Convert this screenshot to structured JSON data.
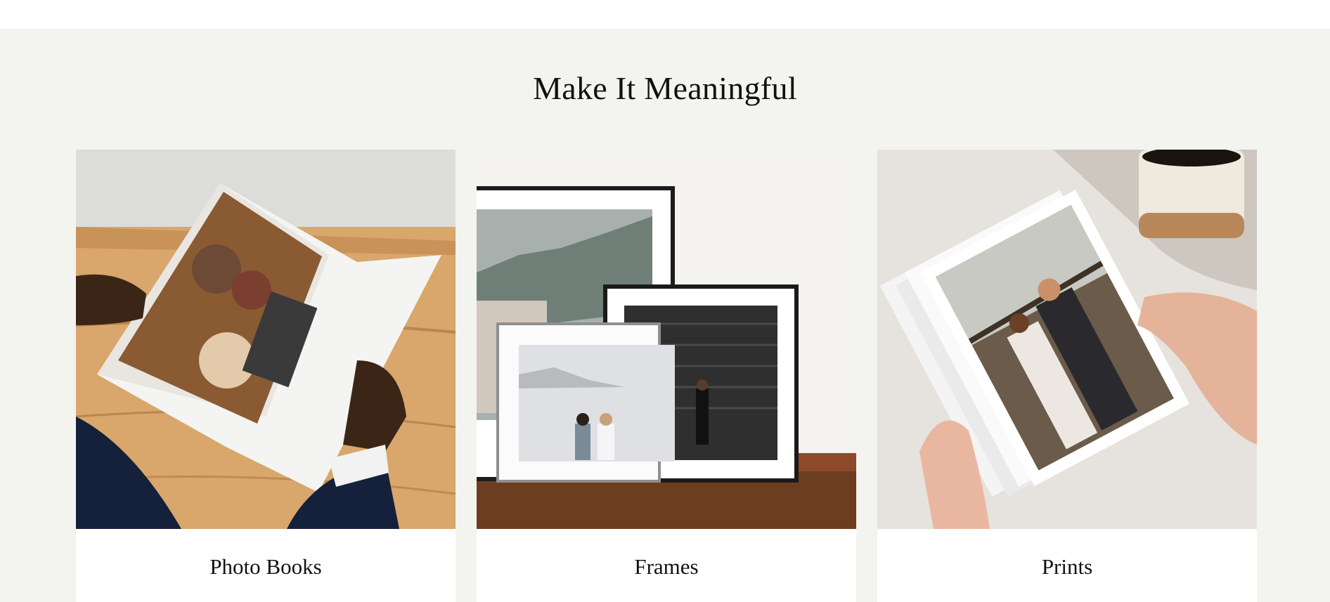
{
  "section": {
    "title": "Make It Meaningful"
  },
  "cards": [
    {
      "label": "Photo Books"
    },
    {
      "label": "Frames"
    },
    {
      "label": "Prints"
    }
  ]
}
